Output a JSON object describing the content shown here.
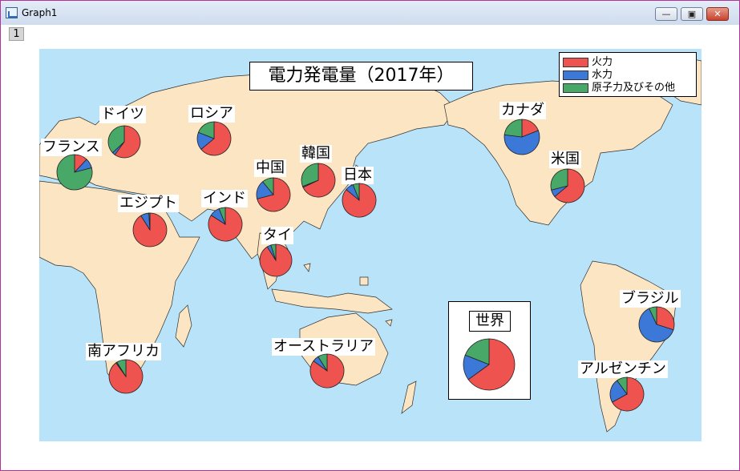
{
  "window": {
    "title": "Graph1",
    "layer_tab": "1"
  },
  "colors": {
    "fire": "#ef5350",
    "hydro": "#3c78d8",
    "nuclear": "#48a868",
    "sea": "#b9e3f9",
    "land": "#fbe5c2"
  },
  "chart_data": {
    "type": "pie",
    "title": "電力発電量（2017年）",
    "legend": {
      "position": "top-right",
      "entries": [
        "火力",
        "水力",
        "原子力及びその他"
      ]
    },
    "series_keys": [
      "fire",
      "hydro",
      "nuclear"
    ],
    "pies": [
      {
        "name": "ドイツ",
        "values": [
          60,
          3,
          37
        ]
      },
      {
        "name": "フランス",
        "values": [
          12,
          9,
          79
        ]
      },
      {
        "name": "ロシア",
        "values": [
          64,
          17,
          19
        ]
      },
      {
        "name": "エジプト",
        "values": [
          91,
          8,
          1
        ]
      },
      {
        "name": "インド",
        "values": [
          84,
          10,
          6
        ]
      },
      {
        "name": "中国",
        "values": [
          71,
          18,
          11
        ]
      },
      {
        "name": "韓国",
        "values": [
          68,
          1,
          31
        ]
      },
      {
        "name": "日本",
        "values": [
          86,
          8,
          6
        ]
      },
      {
        "name": "タイ",
        "values": [
          91,
          4,
          5
        ]
      },
      {
        "name": "南アフリカ",
        "values": [
          90,
          1,
          9
        ]
      },
      {
        "name": "オーストラリア",
        "values": [
          85,
          6,
          9
        ]
      },
      {
        "name": "カナダ",
        "values": [
          19,
          58,
          23
        ]
      },
      {
        "name": "米国",
        "values": [
          64,
          7,
          29
        ]
      },
      {
        "name": "ブラジル",
        "values": [
          30,
          63,
          7
        ]
      },
      {
        "name": "アルゼンチン",
        "values": [
          67,
          23,
          10
        ]
      },
      {
        "name": "世界",
        "values": [
          65,
          16,
          19
        ]
      }
    ]
  }
}
